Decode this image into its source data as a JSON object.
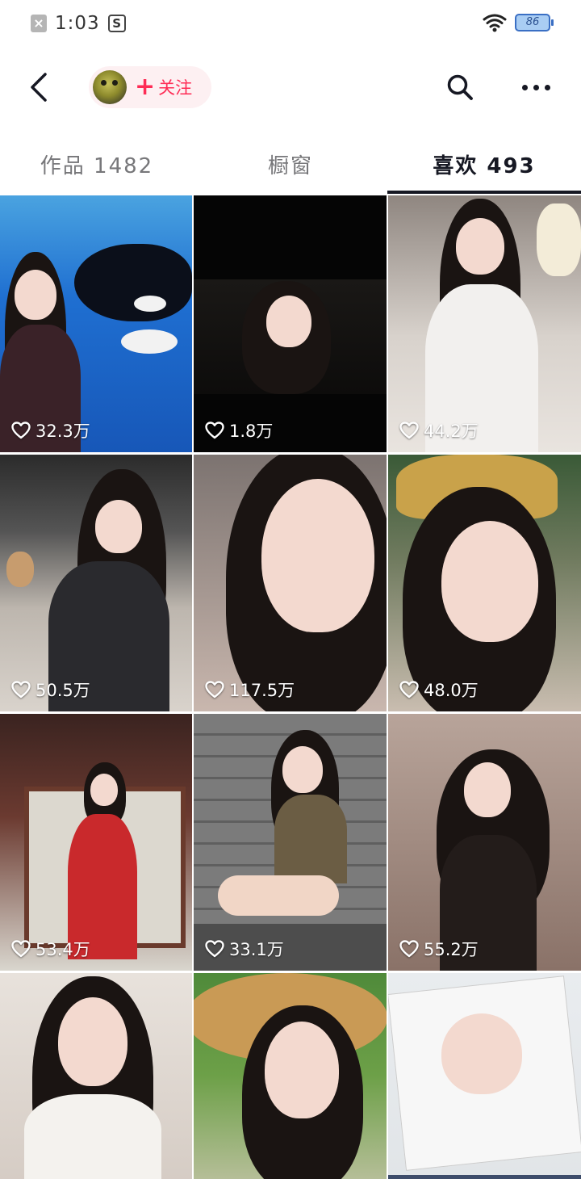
{
  "status_bar": {
    "time": "1:03",
    "battery_level": "86",
    "icons": [
      "notification-x-icon",
      "notification-s-icon",
      "wifi-icon",
      "battery-icon"
    ]
  },
  "nav": {
    "back_icon": "chevron-left-icon",
    "follow_plus": "+",
    "follow_label": "关注",
    "search_icon": "search-icon",
    "more_icon": "more-dots-icon"
  },
  "tabs": [
    {
      "label": "作品 1482",
      "active": false
    },
    {
      "label": "橱窗",
      "active": false
    },
    {
      "label": "喜欢 493",
      "active": true
    }
  ],
  "grid": {
    "like_icon": "heart-outline-icon",
    "items": [
      {
        "likes": "32.3万"
      },
      {
        "likes": "1.8万"
      },
      {
        "likes": "44.2万"
      },
      {
        "likes": "50.5万"
      },
      {
        "likes": "117.5万"
      },
      {
        "likes": "48.0万"
      },
      {
        "likes": "53.4万"
      },
      {
        "likes": "33.1万"
      },
      {
        "likes": "55.2万"
      },
      {
        "likes": ""
      },
      {
        "likes": ""
      },
      {
        "likes": ""
      }
    ]
  },
  "colors": {
    "accent": "#fe2c55",
    "follow_bg": "#fdf0f2",
    "text_primary": "#161823",
    "text_secondary": "#77777a"
  }
}
